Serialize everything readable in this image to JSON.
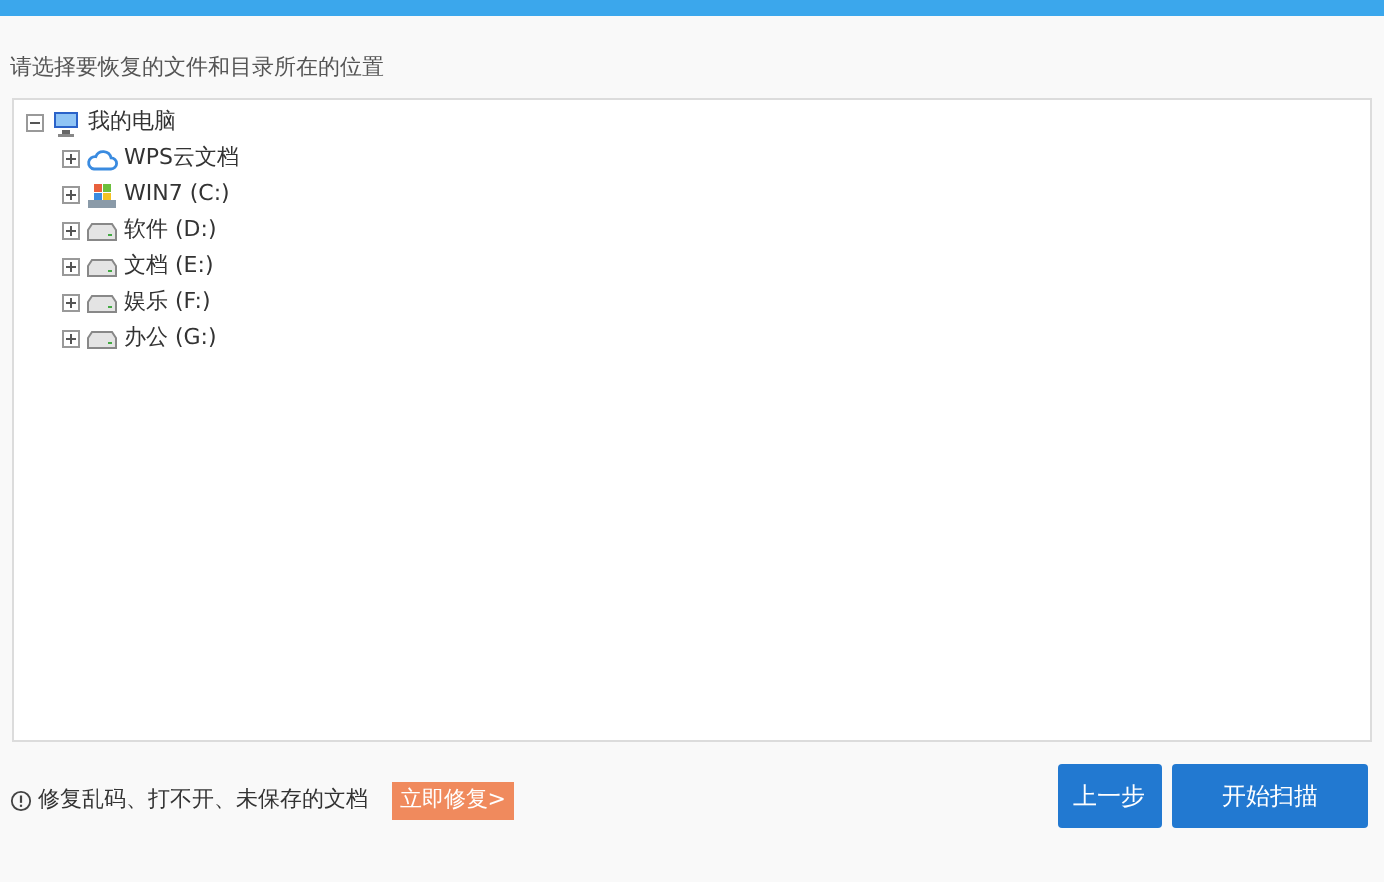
{
  "prompt": "请选择要恢复的文件和目录所在的位置",
  "tree": [
    {
      "label": "我的电脑",
      "kind": "computer",
      "expanded": true,
      "children": [
        {
          "label": "WPS云文档",
          "kind": "cloud",
          "expanded": false
        },
        {
          "label": "WIN7 (C:)",
          "kind": "system",
          "expanded": false
        },
        {
          "label": "软件 (D:)",
          "kind": "drive",
          "expanded": false
        },
        {
          "label": "文档 (E:)",
          "kind": "drive",
          "expanded": false
        },
        {
          "label": "娱乐 (F:)",
          "kind": "drive",
          "expanded": false
        },
        {
          "label": "办公 (G:)",
          "kind": "drive",
          "expanded": false
        }
      ]
    }
  ],
  "footer": {
    "notice": "修复乱码、打不开、未保存的文档",
    "repair_link": "立即修复>"
  },
  "buttons": [
    "上一步",
    "开始扫描"
  ]
}
